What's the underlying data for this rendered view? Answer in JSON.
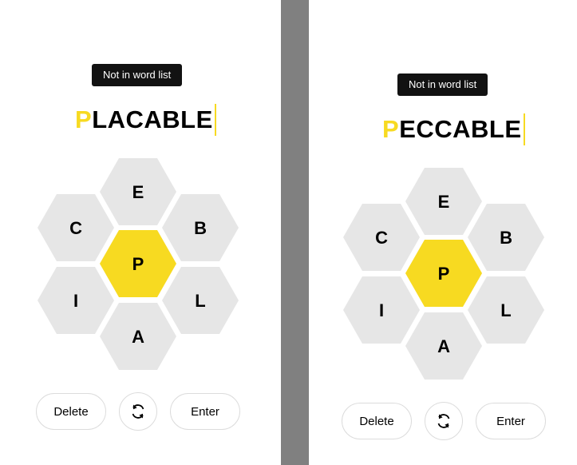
{
  "left": {
    "toast": "Not in word list",
    "word": {
      "first_letter": "P",
      "rest": "LACABLE"
    },
    "hive": {
      "center": "P",
      "top": "E",
      "top_left": "C",
      "top_right": "B",
      "bottom_left": "I",
      "bottom_right": "L",
      "bottom": "A"
    },
    "buttons": {
      "delete": "Delete",
      "enter": "Enter",
      "shuffle_icon": "shuffle-icon"
    }
  },
  "right": {
    "toast": "Not in word list",
    "word": {
      "first_letter": "P",
      "rest": "ECCABLE"
    },
    "hive": {
      "center": "P",
      "top": "E",
      "top_left": "C",
      "top_right": "B",
      "bottom_left": "I",
      "bottom_right": "L",
      "bottom": "A"
    },
    "buttons": {
      "delete": "Delete",
      "enter": "Enter",
      "shuffle_icon": "shuffle-icon"
    }
  },
  "colors": {
    "center_cell": "#f7da21",
    "outer_cell": "#e6e6e6",
    "toast_bg": "#121212",
    "divider": "#808080"
  }
}
